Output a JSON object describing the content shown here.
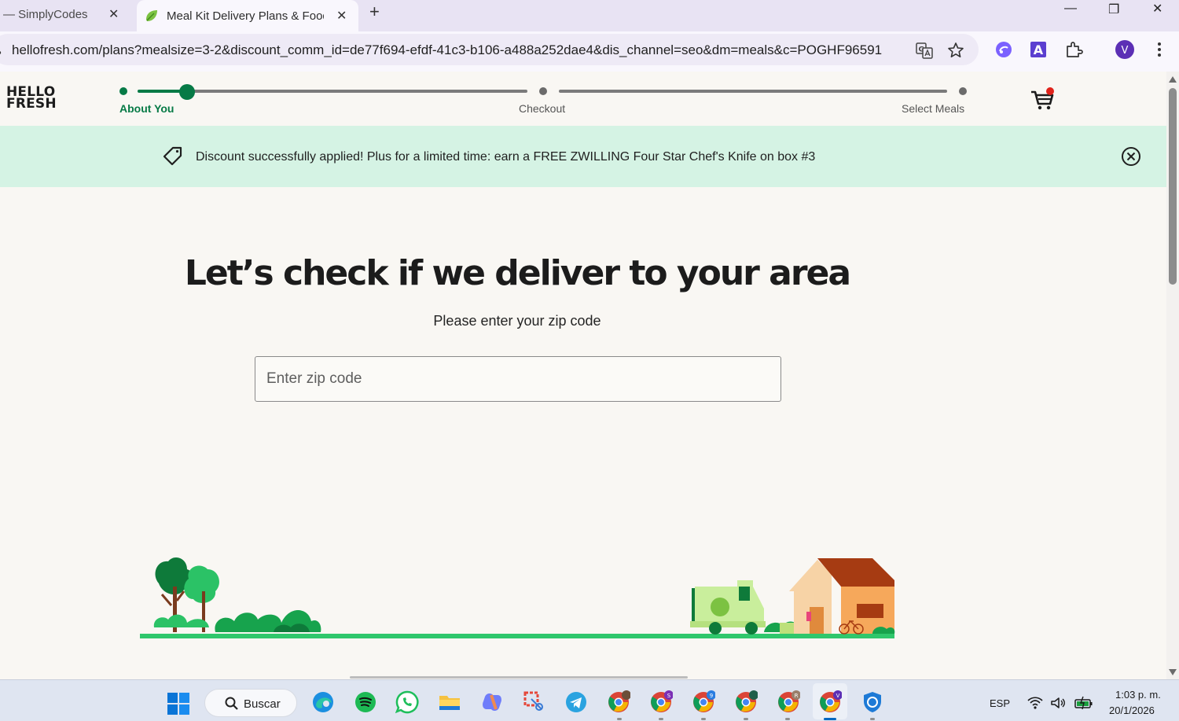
{
  "browser": {
    "tabs": [
      {
        "title": "— SimplyCodes",
        "close": "✕"
      },
      {
        "title": "Meal Kit Delivery Plans & Food",
        "close": "✕",
        "active": true
      }
    ],
    "new_tab": "+",
    "window_controls": {
      "minimize": "—",
      "restore": "❐",
      "close": "✕"
    },
    "url": "hellofresh.com/plans?mealsize=3-2&discount_comm_id=de77f694-efdf-41c3-b106-a488a252dae4&dis_channel=seo&dm=meals&c=POGHF96591",
    "icons": [
      "translate-icon",
      "bookmark-star-icon",
      "copilot-icon",
      "font-extension-icon",
      "extensions-puzzle-icon",
      "profile-avatar-icon",
      "menu-kebab-icon"
    ],
    "profile_initial": "V",
    "extension_letter": "A"
  },
  "header": {
    "logo_line1": "HELLO",
    "logo_line2": "FRESH",
    "steps": [
      {
        "label": "About You",
        "active": true
      },
      {
        "label": "Checkout",
        "active": false
      },
      {
        "label": "Select Meals",
        "active": false
      }
    ],
    "progress_fraction": 0.17
  },
  "banner": {
    "text": "Discount successfully applied! Plus for a limited time: earn a FREE ZWILLING Four Star Chef's Knife on box #3"
  },
  "main": {
    "title": "Let’s check if we deliver to your area",
    "subtitle": "Please enter your zip code",
    "zip_placeholder": "Enter zip code",
    "zip_value": ""
  },
  "taskbar": {
    "search_label": "Buscar",
    "apps": [
      "start-icon",
      "edge-icon",
      "spotify-icon",
      "whatsapp-icon",
      "file-explorer-icon",
      "copilot-icon",
      "snipping-tool-icon",
      "telegram-icon",
      "chrome-profile-icon",
      "chrome-profile-s-icon",
      "chrome-profile-9-icon",
      "chrome-profile-icon",
      "chrome-profile-r-icon",
      "chrome-profile-v-icon",
      "defender-icon"
    ],
    "badges": [
      "S",
      "9",
      "R",
      "V"
    ],
    "language": "ESP",
    "time": "1:03 p. m.",
    "date": "20/1/2026"
  },
  "colors": {
    "brand_green": "#067a46",
    "banner_bg": "#d5f3e4",
    "page_bg": "#f9f7f3",
    "cart_badge": "#e0231b"
  }
}
